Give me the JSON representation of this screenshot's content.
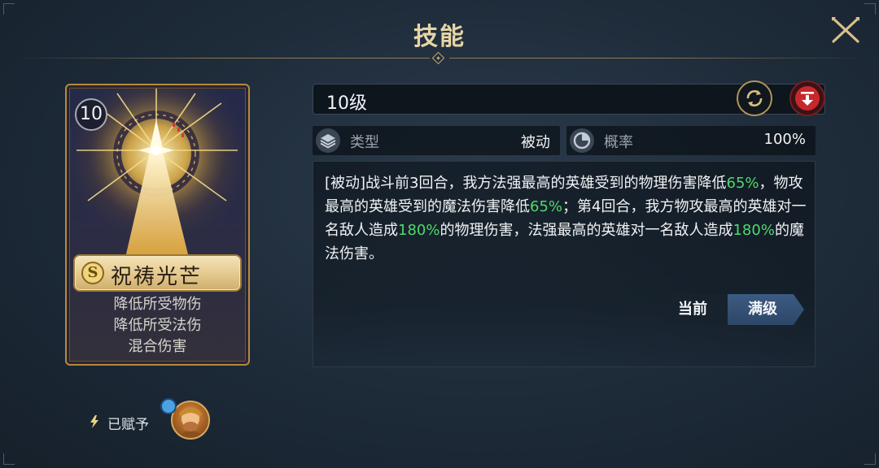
{
  "header": {
    "title": "技能"
  },
  "card": {
    "level": "10",
    "rarity": "S",
    "name": "祝祷光芒",
    "tags": [
      "降低所受物伤",
      "降低所受法伤",
      "混合伤害"
    ]
  },
  "bestowed": {
    "label": "已赋予"
  },
  "skill": {
    "level_label": "10级",
    "type_label": "类型",
    "type_value": "被动",
    "chance_label": "概率",
    "chance_value": "100%",
    "description_parts": [
      {
        "text": "[被动]战斗前3回合，我方法强最高的英雄受到的物理伤害降低",
        "hl": false
      },
      {
        "text": "65%",
        "hl": true
      },
      {
        "text": "，物攻最高的英雄受到的魔法伤害降低",
        "hl": false
      },
      {
        "text": "65%",
        "hl": true
      },
      {
        "text": "；第4回合，我方物攻最高的英雄对一名敌人造成",
        "hl": false
      },
      {
        "text": "180%",
        "hl": true
      },
      {
        "text": "的物理伤害，法强最高的英雄对一名敌人造成",
        "hl": false
      },
      {
        "text": "180%",
        "hl": true
      },
      {
        "text": "的魔法伤害。",
        "hl": false
      }
    ]
  },
  "toggle": {
    "current_label": "当前",
    "max_label": "满级",
    "selected": "max"
  },
  "colors": {
    "title": "#e7d5a6",
    "highlight": "#4fd96a",
    "gold_border": "#b68a3c",
    "selected_tab": "#3c5b83"
  },
  "icons": {
    "close": "close-x-icon",
    "refresh": "refresh-icon",
    "download": "download-arrow-icon",
    "type": "layers-icon",
    "chance": "pie-chart-icon",
    "bestow": "lightning-icon"
  }
}
